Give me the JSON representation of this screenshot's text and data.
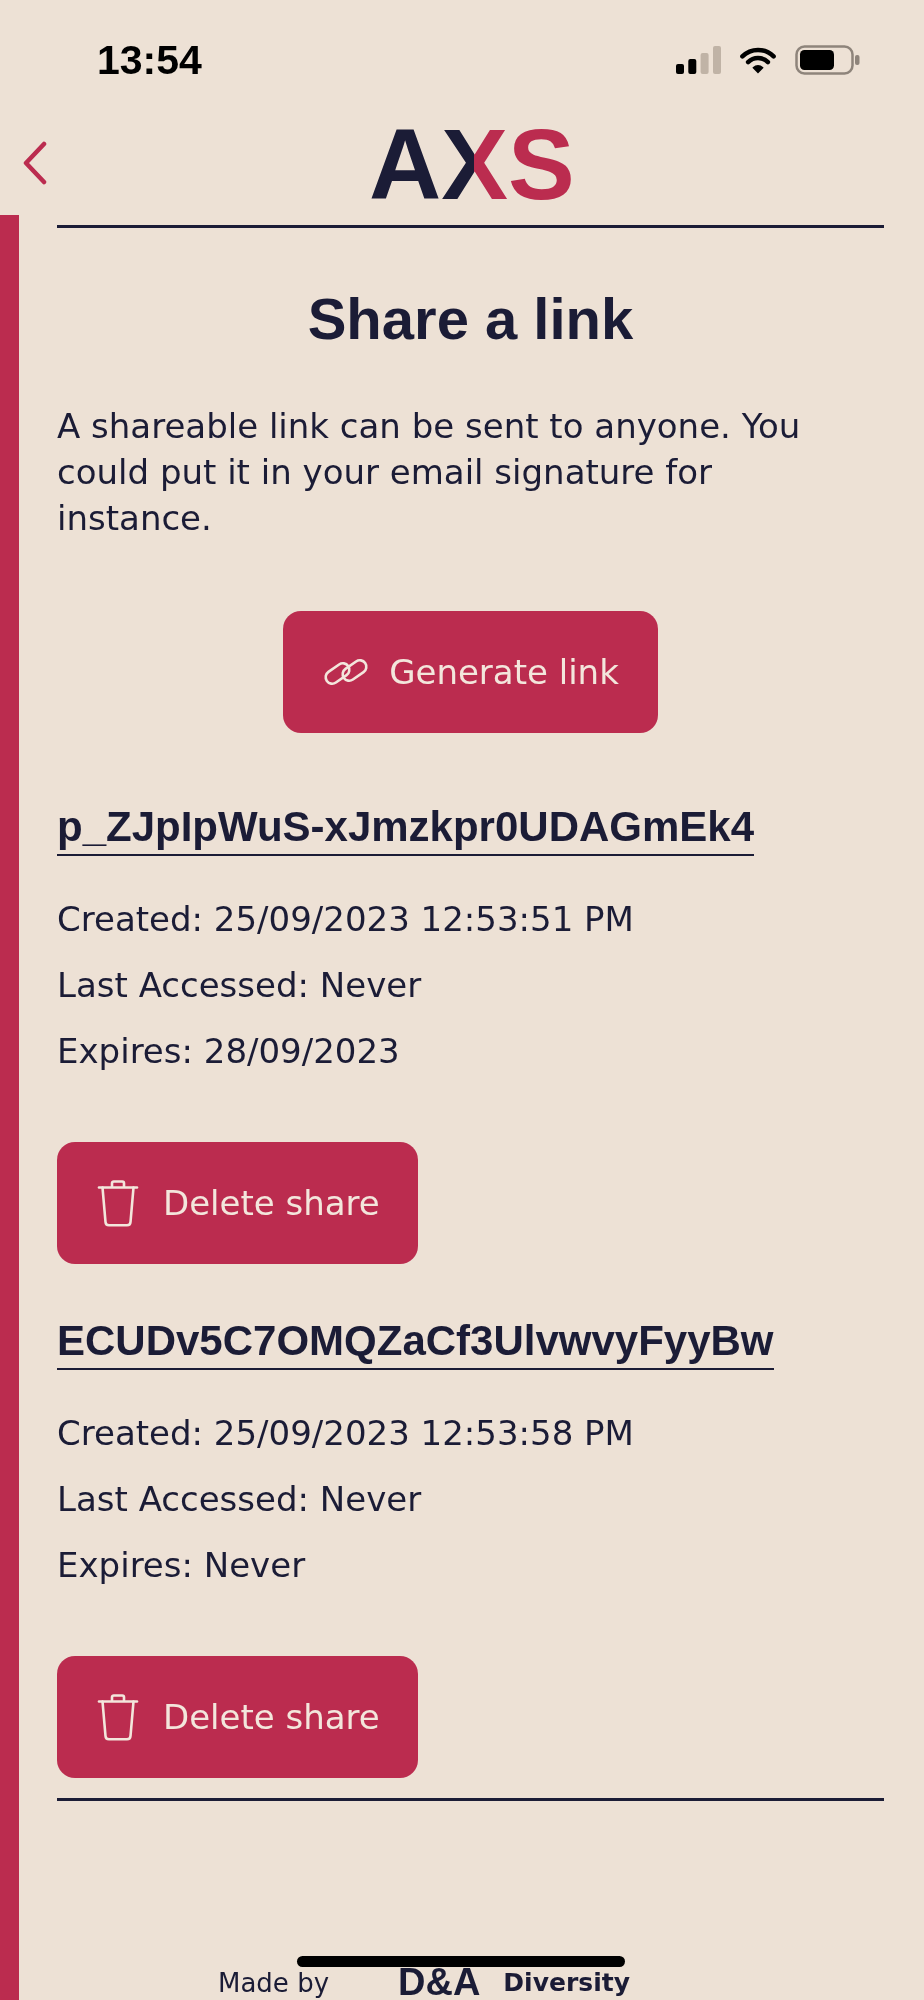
{
  "status_bar": {
    "time": "13:54"
  },
  "header": {
    "logo": "AXS"
  },
  "page": {
    "title": "Share a link",
    "description": "A shareable link can be sent to anyone. You could put it in your email signature for instance.",
    "generate_button": "Generate link"
  },
  "shares": [
    {
      "link": "p_ZJpIpWuS-xJmzkpr0UDAGmEk4",
      "created": "Created: 25/09/2023 12:53:51 PM",
      "last_accessed": "Last Accessed: Never",
      "expires": "Expires: 28/09/2023",
      "delete_button": "Delete share"
    },
    {
      "link": "ECUDv5C7OMQZaCf3UlvwvyFyyBw",
      "created": "Created: 25/09/2023 12:53:58 PM",
      "last_accessed": "Last Accessed: Never",
      "expires": "Expires: Never",
      "delete_button": "Delete share"
    }
  ],
  "footer": {
    "made_by": "Made by",
    "logo": "D&A",
    "tagline": "Diversity"
  }
}
